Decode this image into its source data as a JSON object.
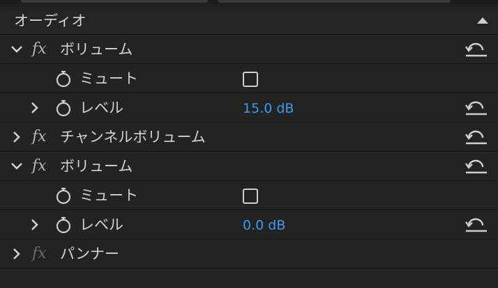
{
  "panel": {
    "section_title": "オーディオ"
  },
  "effects": [
    {
      "name": "ボリューム",
      "expanded": true,
      "params": [
        {
          "name": "ミュート",
          "type": "checkbox",
          "checked": false
        },
        {
          "name": "レベル",
          "type": "value",
          "value": "15.0 dB"
        }
      ]
    },
    {
      "name": "チャンネルボリューム",
      "expanded": false
    },
    {
      "name": "ボリューム",
      "expanded": true,
      "params": [
        {
          "name": "ミュート",
          "type": "checkbox",
          "checked": false
        },
        {
          "name": "レベル",
          "type": "value",
          "value": "0.0 dB"
        }
      ]
    },
    {
      "name": "パンナー",
      "expanded": false,
      "fx_disabled": true
    }
  ],
  "fx_symbol": "fx",
  "colors": {
    "background": "#232323",
    "value_blue": "#3d9be9",
    "divider": "#141414"
  }
}
